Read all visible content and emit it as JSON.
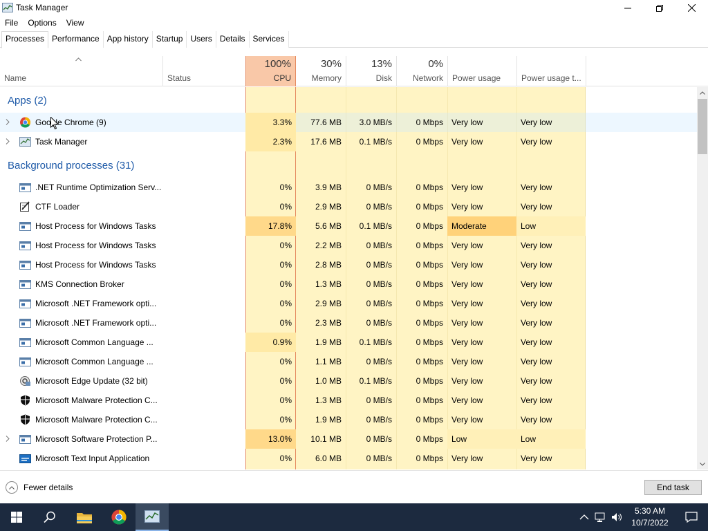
{
  "window": {
    "title": "Task Manager"
  },
  "menu": [
    "File",
    "Options",
    "View"
  ],
  "tabs": [
    "Processes",
    "Performance",
    "App history",
    "Startup",
    "Users",
    "Details",
    "Services"
  ],
  "active_tab": "Processes",
  "header": {
    "name": "Name",
    "status": "Status",
    "cpu_pct": "100%",
    "cpu": "CPU",
    "mem_pct": "30%",
    "mem": "Memory",
    "disk_pct": "13%",
    "disk": "Disk",
    "net_pct": "0%",
    "net": "Network",
    "power": "Power usage",
    "power_trend": "Power usage t..."
  },
  "groups": {
    "apps": "Apps (2)",
    "background": "Background processes (31)"
  },
  "apps": [
    {
      "name": "Google Chrome (9)",
      "icon": "chrome-icon",
      "cpu": "3.3%",
      "mem": "77.6 MB",
      "disk": "3.0 MB/s",
      "net": "0 Mbps",
      "power": "Very low",
      "trend": "Very low",
      "expand": true
    },
    {
      "name": "Task Manager",
      "icon": "task-manager-icon",
      "cpu": "2.3%",
      "mem": "17.6 MB",
      "disk": "0.1 MB/s",
      "net": "0 Mbps",
      "power": "Very low",
      "trend": "Very low",
      "expand": true
    }
  ],
  "background": [
    {
      "name": ".NET Runtime Optimization Serv...",
      "icon": "service-window-icon",
      "cpu": "0%",
      "mem": "3.9 MB",
      "disk": "0 MB/s",
      "net": "0 Mbps",
      "power": "Very low",
      "trend": "Very low",
      "expand": false
    },
    {
      "name": "CTF Loader",
      "icon": "ctf-loader-icon",
      "cpu": "0%",
      "mem": "2.9 MB",
      "disk": "0 MB/s",
      "net": "0 Mbps",
      "power": "Very low",
      "trend": "Very low",
      "expand": false
    },
    {
      "name": "Host Process for Windows Tasks",
      "icon": "service-window-icon",
      "cpu": "17.8%",
      "mem": "5.6 MB",
      "disk": "0.1 MB/s",
      "net": "0 Mbps",
      "power": "Moderate",
      "trend": "Low",
      "expand": false
    },
    {
      "name": "Host Process for Windows Tasks",
      "icon": "service-window-icon",
      "cpu": "0%",
      "mem": "2.2 MB",
      "disk": "0 MB/s",
      "net": "0 Mbps",
      "power": "Very low",
      "trend": "Very low",
      "expand": false
    },
    {
      "name": "Host Process for Windows Tasks",
      "icon": "service-window-icon",
      "cpu": "0%",
      "mem": "2.8 MB",
      "disk": "0 MB/s",
      "net": "0 Mbps",
      "power": "Very low",
      "trend": "Very low",
      "expand": false
    },
    {
      "name": "KMS Connection Broker",
      "icon": "service-window-icon",
      "cpu": "0%",
      "mem": "1.3 MB",
      "disk": "0 MB/s",
      "net": "0 Mbps",
      "power": "Very low",
      "trend": "Very low",
      "expand": false
    },
    {
      "name": "Microsoft .NET Framework opti...",
      "icon": "service-window-icon",
      "cpu": "0%",
      "mem": "2.9 MB",
      "disk": "0 MB/s",
      "net": "0 Mbps",
      "power": "Very low",
      "trend": "Very low",
      "expand": false
    },
    {
      "name": "Microsoft .NET Framework opti...",
      "icon": "service-window-icon",
      "cpu": "0%",
      "mem": "2.3 MB",
      "disk": "0 MB/s",
      "net": "0 Mbps",
      "power": "Very low",
      "trend": "Very low",
      "expand": false
    },
    {
      "name": "Microsoft Common Language ...",
      "icon": "service-window-icon",
      "cpu": "0.9%",
      "mem": "1.9 MB",
      "disk": "0.1 MB/s",
      "net": "0 Mbps",
      "power": "Very low",
      "trend": "Very low",
      "expand": false
    },
    {
      "name": "Microsoft Common Language ...",
      "icon": "service-window-icon",
      "cpu": "0%",
      "mem": "1.1 MB",
      "disk": "0 MB/s",
      "net": "0 Mbps",
      "power": "Very low",
      "trend": "Very low",
      "expand": false
    },
    {
      "name": "Microsoft Edge Update (32 bit)",
      "icon": "edge-update-icon",
      "cpu": "0%",
      "mem": "1.0 MB",
      "disk": "0.1 MB/s",
      "net": "0 Mbps",
      "power": "Very low",
      "trend": "Very low",
      "expand": false
    },
    {
      "name": "Microsoft Malware Protection C...",
      "icon": "shield-icon",
      "cpu": "0%",
      "mem": "1.3 MB",
      "disk": "0 MB/s",
      "net": "0 Mbps",
      "power": "Very low",
      "trend": "Very low",
      "expand": false
    },
    {
      "name": "Microsoft Malware Protection C...",
      "icon": "shield-icon",
      "cpu": "0%",
      "mem": "1.9 MB",
      "disk": "0 MB/s",
      "net": "0 Mbps",
      "power": "Very low",
      "trend": "Very low",
      "expand": false
    },
    {
      "name": "Microsoft Software Protection P...",
      "icon": "service-window-icon",
      "cpu": "13.0%",
      "mem": "10.1 MB",
      "disk": "0 MB/s",
      "net": "0 Mbps",
      "power": "Low",
      "trend": "Low",
      "expand": true
    },
    {
      "name": "Microsoft Text Input Application",
      "icon": "text-input-icon",
      "cpu": "0%",
      "mem": "6.0 MB",
      "disk": "0 MB/s",
      "net": "0 Mbps",
      "power": "Very low",
      "trend": "Very low",
      "expand": false
    }
  ],
  "footer": {
    "fewer_details": "Fewer details",
    "end_task": "End task"
  },
  "clock": {
    "time": "5:30 AM",
    "date": "10/7/2022"
  },
  "colors": {
    "cpu_header": "#f9c8a8",
    "cpu_light": "#fff4c4",
    "cpu_heavy": "#ffd98a",
    "other_col": "#fff4c4",
    "power_moderate": "#ffd27a",
    "power_low": "#fff0b8",
    "accent": "#1e5aa8"
  }
}
